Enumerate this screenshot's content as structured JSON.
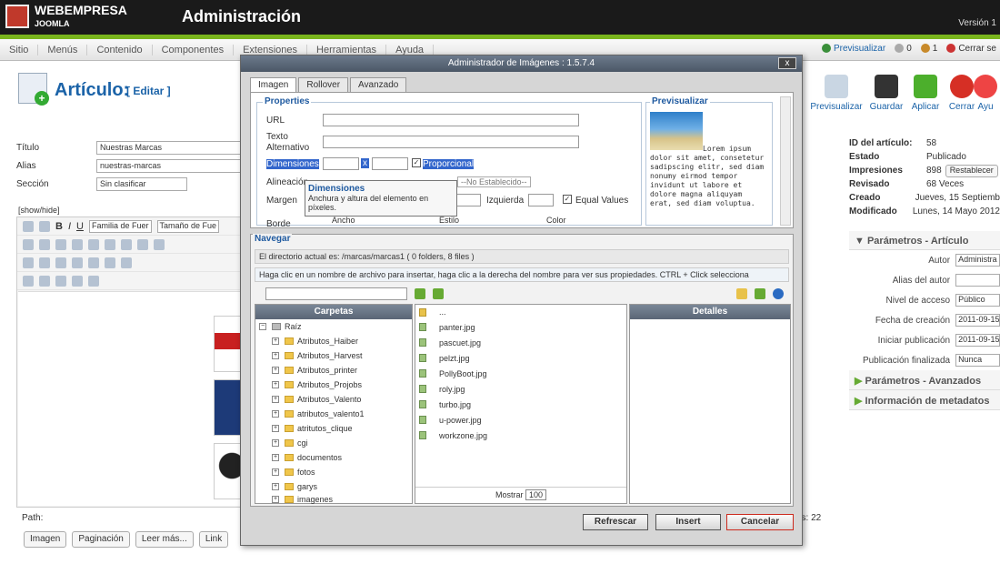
{
  "brand": {
    "line1": "WEBEMPRESA",
    "line2": "JOOMLA"
  },
  "app_title": "Administración",
  "version": "Versión 1",
  "menu": [
    "Sitio",
    "Menús",
    "Contenido",
    "Componentes",
    "Extensiones",
    "Herramientas",
    "Ayuda"
  ],
  "menu_right": {
    "preview": "Previsualizar",
    "count1": "0",
    "count2": "1",
    "logout": "Cerrar se"
  },
  "header": {
    "title": "Artículo:",
    "subtitle": "[ Editar ]"
  },
  "toolbar": [
    "Previsualizar",
    "Guardar",
    "Aplicar",
    "Cerrar",
    "Ayu"
  ],
  "form": {
    "titulo_label": "Título",
    "titulo": "Nuestras Marcas",
    "alias_label": "Alias",
    "alias": "nuestras-marcas",
    "seccion_label": "Sección",
    "seccion": "Sin clasificar"
  },
  "editor": {
    "showhide": "[show/hide]",
    "font_family": "Familia de Fuer",
    "font_size": "Tamaño de Fue",
    "path": "Path:",
    "words": "ds: 22"
  },
  "bottom_buttons": [
    "Imagen",
    "Paginación",
    "Leer más...",
    "Link"
  ],
  "article_info": [
    [
      "ID del artículo:",
      "58"
    ],
    [
      "Estado",
      "Publicado"
    ],
    [
      "Impresiones",
      "898"
    ],
    [
      "Revisado",
      "68 Veces"
    ],
    [
      "Creado",
      "Jueves, 15 Septiemb"
    ],
    [
      "Modificado",
      "Lunes, 14 Mayo 2012"
    ]
  ],
  "reset_label": "Restablecer",
  "params": {
    "head": "Parámetros - Artículo",
    "rows": [
      [
        "Autor",
        "Administra"
      ],
      [
        "Alias del autor",
        ""
      ],
      [
        "Nivel de acceso",
        "Público"
      ],
      [
        "Fecha de creación",
        "2011-09-15"
      ],
      [
        "Iniciar publicación",
        "2011-09-15"
      ],
      [
        "Publicación finalizada",
        "Nunca"
      ]
    ],
    "advanced": "Parámetros - Avanzados",
    "meta": "Información de metadatos"
  },
  "modal": {
    "title": "Administrador de Imágenes : 1.5.7.4",
    "close": "x",
    "tabs": [
      "Imagen",
      "Rollover",
      "Avanzado"
    ],
    "props_legend": "Properties",
    "url": "URL",
    "alt": "Texto Alternativo",
    "dims": "Dimensiones",
    "dims_x": "x",
    "proportional": "Proporcional",
    "align": "Alineación",
    "align_val": "--No Establecido--",
    "margin": "Margen",
    "left": "Izquierda",
    "equal": "Equal Values",
    "border": "Borde",
    "ancho": "Ancho",
    "estilo": "Estilo",
    "color": "Color",
    "tooltip_title": "Dimensiones",
    "tooltip_text": "Anchura y altura del elemento en píxeles.",
    "preview_legend": "Previsualizar",
    "preview_text": "Lorem ipsum dolor sit amet, consetetur sadipscing elitr, sed diam nonumy eirmod tempor invidunt ut labore et dolore magna aliquyam erat, sed diam voluptua.",
    "nav_legend": "Navegar",
    "dir": "El directorio actual es: /marcas/marcas1 ( 0 folders, 8 files )",
    "help": "Haga clic en un nombre de archivo para insertar, haga clic a la derecha del nombre para ver sus propiedades. CTRL + Click selecciona",
    "folders_head": "Carpetas",
    "root": "Raíz",
    "folders": [
      "Atributos_Haiber",
      "Atributos_Harvest",
      "Atributos_printer",
      "Atributos_Projobs",
      "Atributos_Valento",
      "atributos_valento1",
      "atritutos_clique",
      "cgi",
      "documentos",
      "fotos",
      "garys",
      "imagenes"
    ],
    "parent": "...",
    "files": [
      "panter.jpg",
      "pascuet.jpg",
      "pelzt.jpg",
      "PollyBoot.jpg",
      "roly.jpg",
      "turbo.jpg",
      "u-power.jpg",
      "workzone.jpg"
    ],
    "details_head": "Detalles",
    "show": "Mostrar",
    "show_val": "100",
    "refresh": "Refrescar",
    "insert": "Insert",
    "cancel": "Cancelar"
  },
  "colors": {
    "accent": "#7ab51d",
    "link": "#1b63a8",
    "cancel": "#cc2a1e"
  }
}
